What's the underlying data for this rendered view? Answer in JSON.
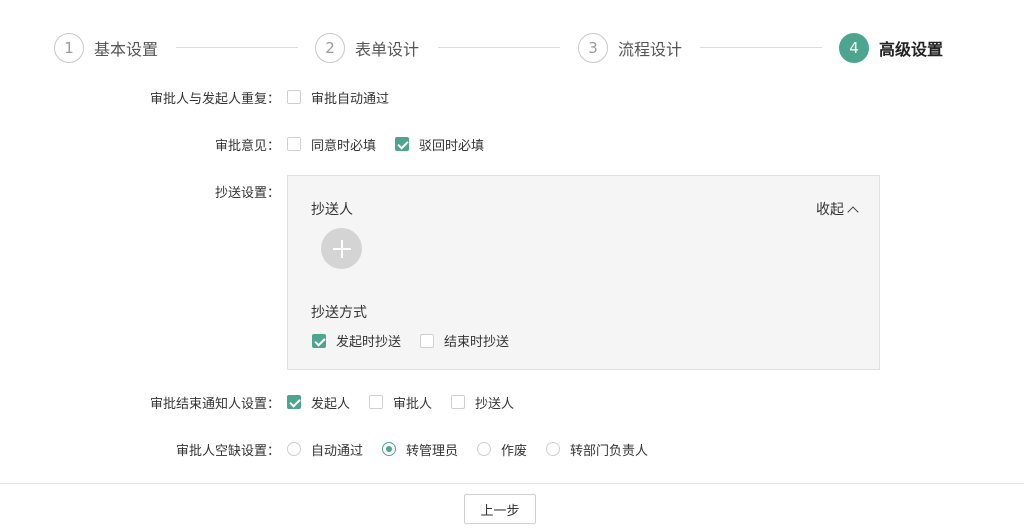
{
  "steps": [
    {
      "num": "1",
      "label": "基本设置",
      "active": false
    },
    {
      "num": "2",
      "label": "表单设计",
      "active": false
    },
    {
      "num": "3",
      "label": "流程设计",
      "active": false
    },
    {
      "num": "4",
      "label": "高级设置",
      "active": true
    }
  ],
  "dedupe": {
    "label": "审批人与发起人重复：",
    "options": [
      {
        "label": "审批自动通过",
        "checked": false
      }
    ]
  },
  "opinion": {
    "label": "审批意见：",
    "options": [
      {
        "label": "同意时必填",
        "checked": false
      },
      {
        "label": "驳回时必填",
        "checked": true
      }
    ]
  },
  "cc": {
    "label": "抄送设置：",
    "recipients_title": "抄送人",
    "collapse_label": "收起",
    "mode_title": "抄送方式",
    "mode_options": [
      {
        "label": "发起时抄送",
        "checked": true
      },
      {
        "label": "结束时抄送",
        "checked": false
      }
    ]
  },
  "notify": {
    "label": "审批结束通知人设置：",
    "options": [
      {
        "label": "发起人",
        "checked": true
      },
      {
        "label": "审批人",
        "checked": false
      },
      {
        "label": "抄送人",
        "checked": false
      }
    ]
  },
  "vacancy": {
    "label": "审批人空缺设置：",
    "options": [
      {
        "label": "自动通过",
        "checked": false
      },
      {
        "label": "转管理员",
        "checked": true
      },
      {
        "label": "作废",
        "checked": false
      },
      {
        "label": "转部门负责人",
        "checked": false
      }
    ]
  },
  "footer": {
    "prev_label": "上一步"
  },
  "colors": {
    "accent": "#4da58f",
    "panel_bg": "#f5f5f5"
  }
}
